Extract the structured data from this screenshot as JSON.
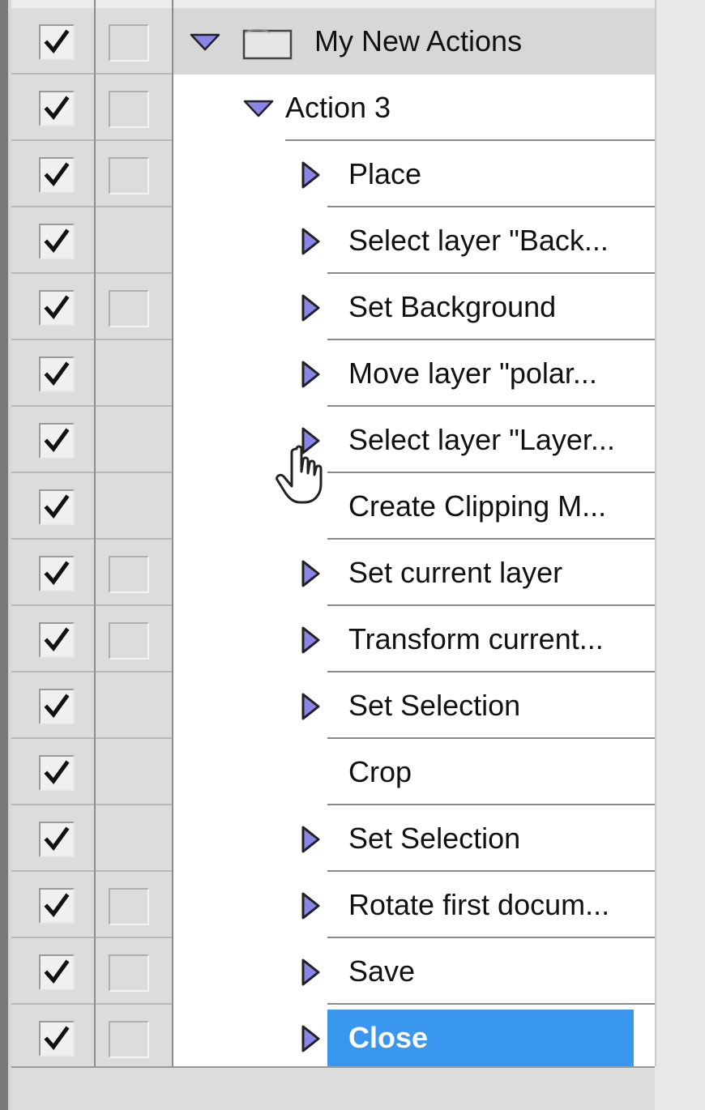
{
  "panel": {
    "folder": {
      "name": "My New Actions",
      "icon": "folder-icon",
      "expanded": true
    },
    "action": {
      "name": "Action 3",
      "expanded": true
    },
    "steps": [
      {
        "label": "Place",
        "expandable": true,
        "dialog_toggle": true
      },
      {
        "label": "Select layer \"Back...",
        "expandable": true,
        "dialog_toggle": false
      },
      {
        "label": "Set Background",
        "expandable": true,
        "dialog_toggle": true
      },
      {
        "label": "Move layer \"polar...",
        "expandable": true,
        "dialog_toggle": false
      },
      {
        "label": "Select layer \"Layer...",
        "expandable": true,
        "dialog_toggle": false
      },
      {
        "label": "Create Clipping M...",
        "expandable": false,
        "dialog_toggle": false
      },
      {
        "label": "Set current layer",
        "expandable": true,
        "dialog_toggle": true
      },
      {
        "label": "Transform current...",
        "expandable": true,
        "dialog_toggle": true
      },
      {
        "label": "Set Selection",
        "expandable": true,
        "dialog_toggle": false
      },
      {
        "label": "Crop",
        "expandable": false,
        "dialog_toggle": false
      },
      {
        "label": "Set Selection",
        "expandable": true,
        "dialog_toggle": false
      },
      {
        "label": "Rotate first docum...",
        "expandable": true,
        "dialog_toggle": true
      },
      {
        "label": "Save",
        "expandable": true,
        "dialog_toggle": true
      },
      {
        "label": "Close",
        "expandable": true,
        "dialog_toggle": true,
        "selected": true
      }
    ]
  },
  "colors": {
    "selection": "#3a97f0",
    "triangle": "#8a86e8",
    "folder_row": "#d7d7d7"
  }
}
